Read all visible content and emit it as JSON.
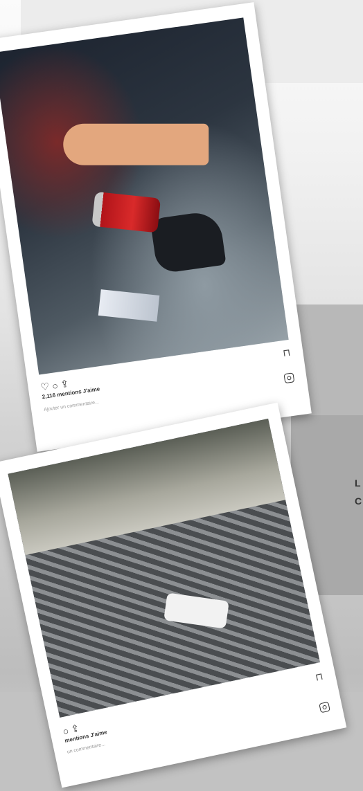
{
  "side_text": [
    "L",
    "C"
  ],
  "posts": [
    {
      "likes": "2,116 mentions J'aime",
      "comment_placeholder": "Ajouter un commentaire...",
      "icons": [
        "heart-icon",
        "comment-icon",
        "share-icon",
        "bookmark-icon",
        "instagram-icon"
      ]
    },
    {
      "likes": "mentions J'aime",
      "comment_placeholder": "un commentaire...",
      "icons": [
        "heart-icon",
        "comment-icon",
        "share-icon",
        "bookmark-icon",
        "instagram-icon"
      ]
    }
  ]
}
